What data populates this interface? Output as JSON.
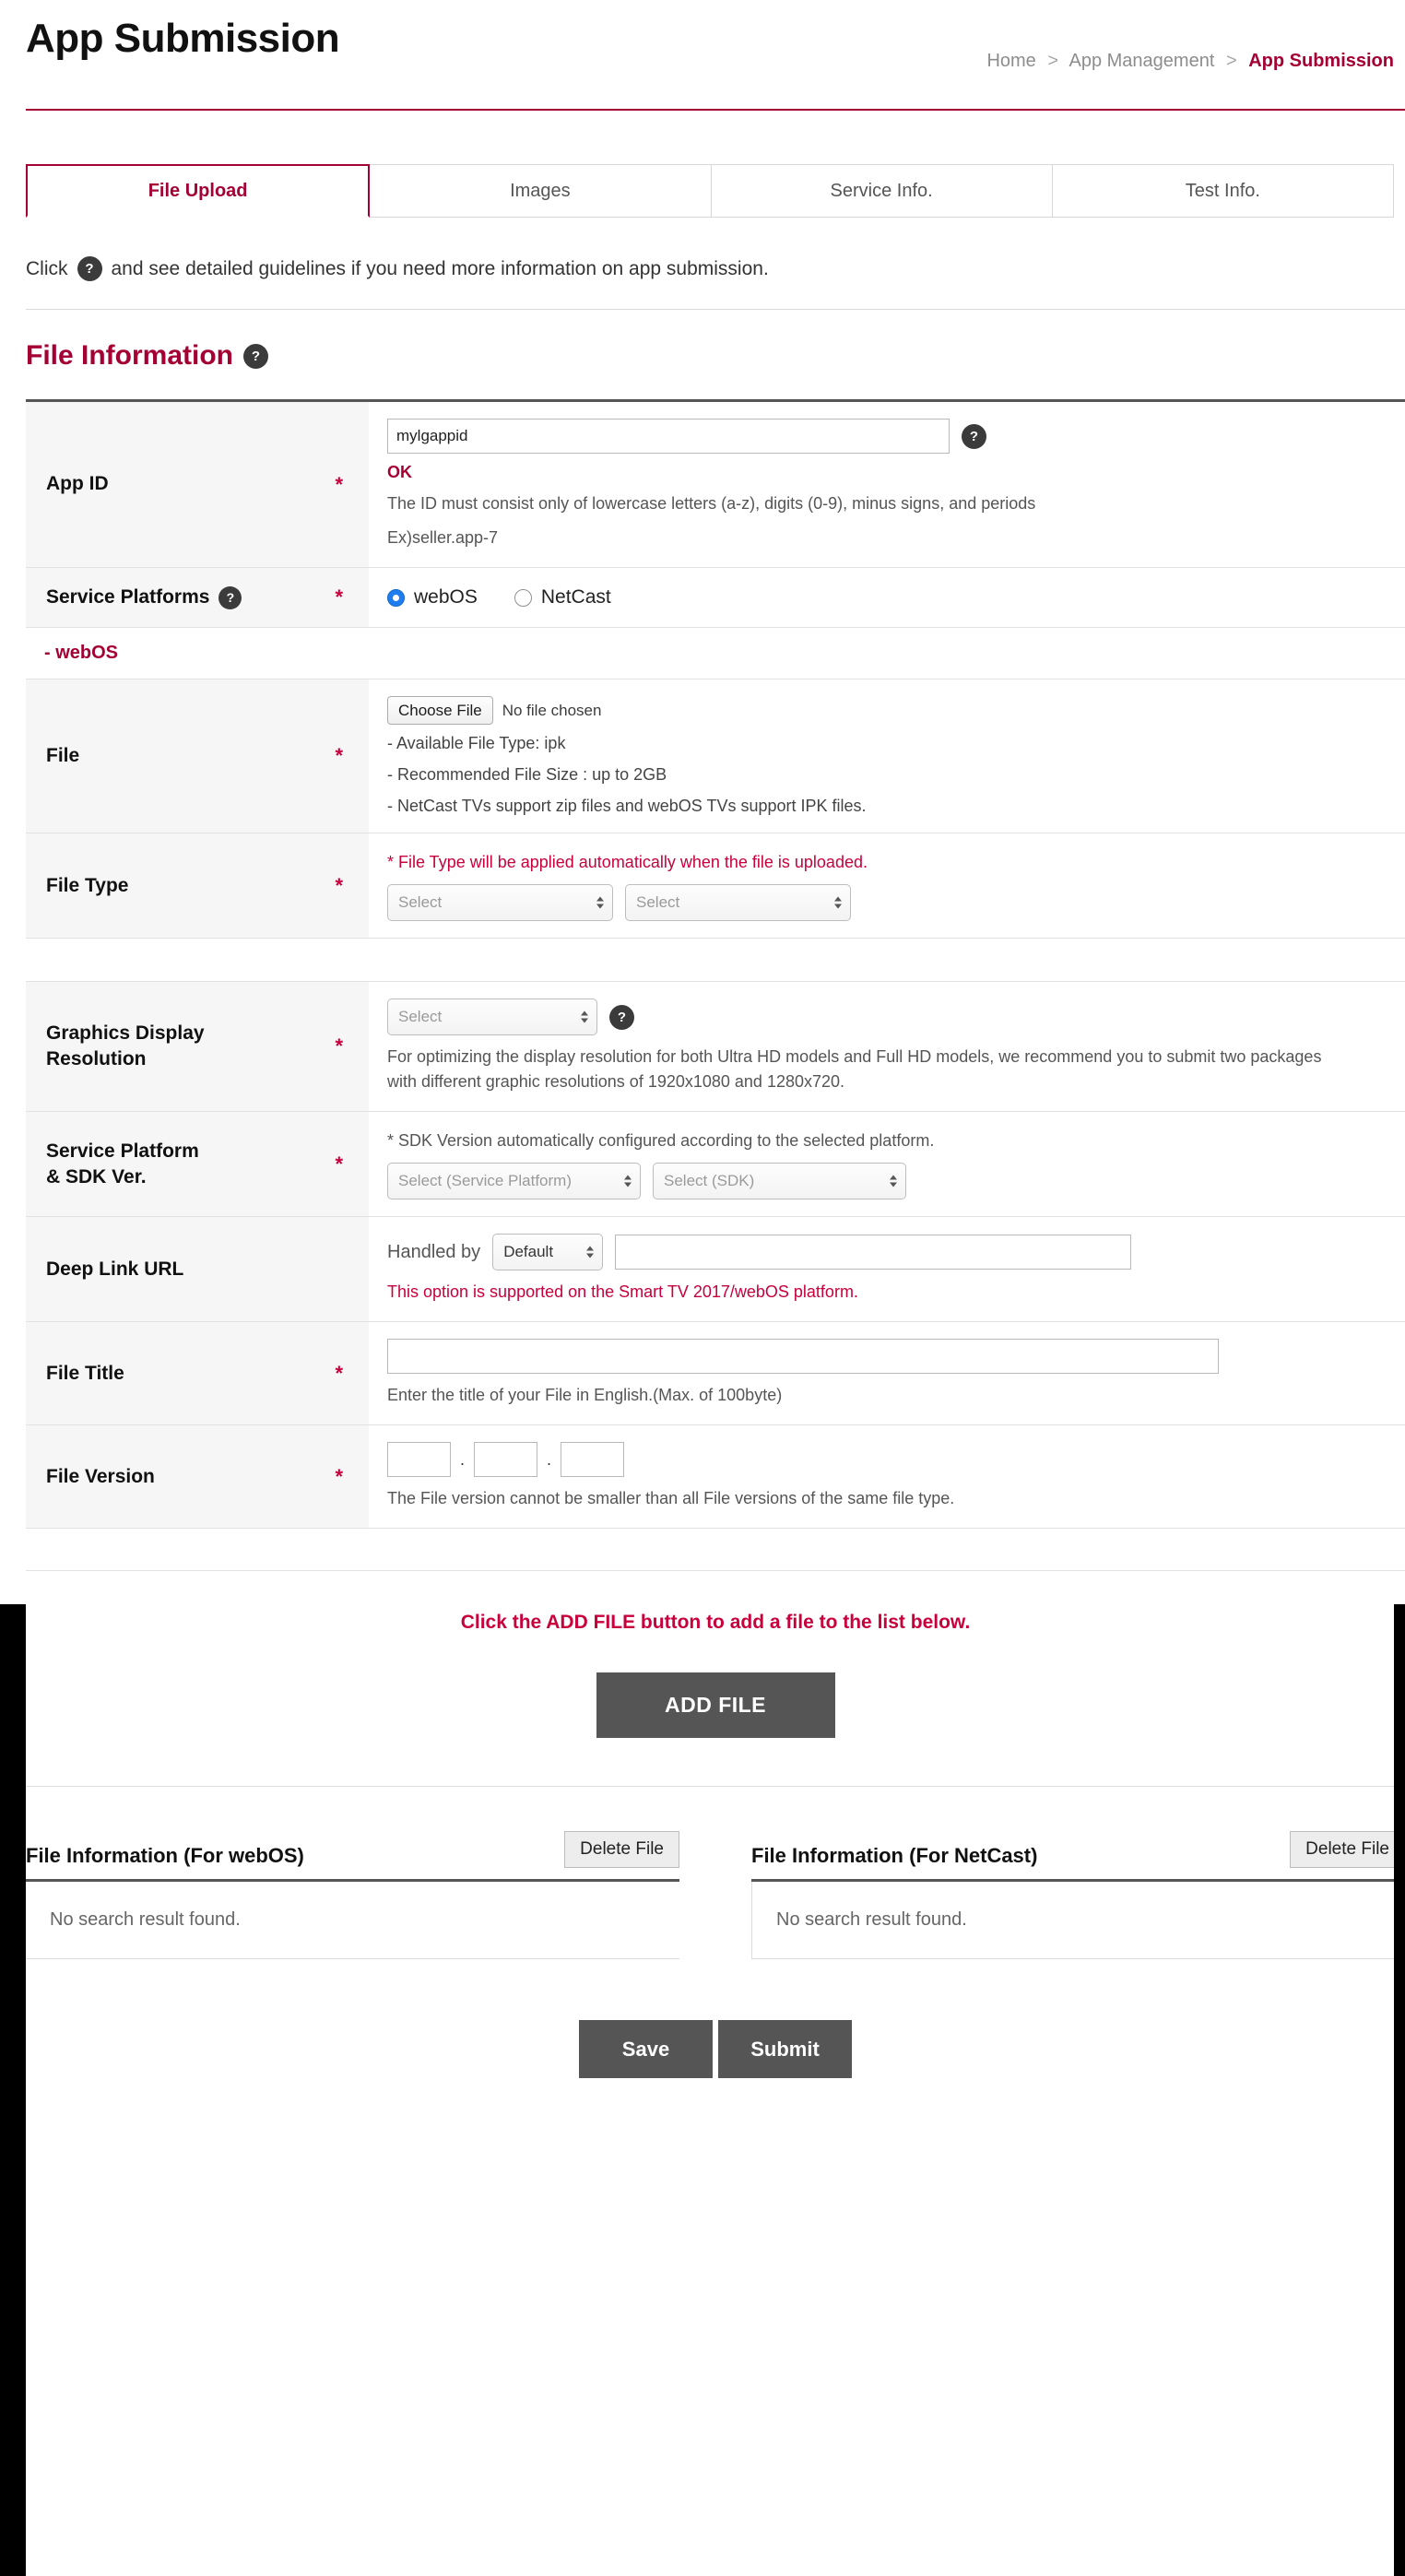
{
  "header": {
    "title": "App Submission",
    "breadcrumb": {
      "home": "Home",
      "section": "App Management",
      "current": "App Submission",
      "separator": ">"
    }
  },
  "tabs": [
    {
      "label": "File Upload",
      "active": true
    },
    {
      "label": "Images",
      "active": false
    },
    {
      "label": "Service Info.",
      "active": false
    },
    {
      "label": "Test Info.",
      "active": false
    }
  ],
  "notice": {
    "before": "Click",
    "icon": "help-icon",
    "after": "and see detailed guidelines if you need more information on app submission."
  },
  "section": {
    "title": "File Information",
    "help_icon": "help-icon"
  },
  "form": {
    "app_id": {
      "label": "App ID",
      "required": "*",
      "value": "mylgappid",
      "status": "OK",
      "hint_line1": "The ID must consist only of lowercase letters (a-z), digits (0-9), minus signs, and periods",
      "hint_line2": "Ex)seller.app-7"
    },
    "service_platforms": {
      "label": "Service Platforms",
      "required": "*",
      "options": [
        {
          "label": "webOS",
          "selected": true
        },
        {
          "label": "NetCast",
          "selected": false
        }
      ]
    },
    "subsection_webos": "- webOS",
    "file": {
      "label": "File",
      "required": "*",
      "choose_button": "Choose File",
      "no_file_text": "No file chosen",
      "bullets": [
        "- Available File Type: ipk",
        "- Recommended File Size : up to 2GB",
        "- NetCast TVs support zip files and webOS TVs support IPK files."
      ]
    },
    "file_type": {
      "label": "File Type",
      "required": "*",
      "note": "* File Type will be applied automatically when the file is uploaded.",
      "select_left": "Select",
      "select_right": "Select"
    },
    "graphics_resolution": {
      "label_line1": "Graphics Display",
      "label_line2": "Resolution",
      "required": "*",
      "select": "Select",
      "hint": "For optimizing the display resolution for both Ultra HD models and Full HD models, we recommend you to submit two packages with different graphic resolutions of 1920x1080 and 1280x720."
    },
    "service_platform_sdk": {
      "label_line1": "Service Platform",
      "label_line2": "& SDK Ver.",
      "required": "*",
      "note": "* SDK Version automatically configured according to the selected platform.",
      "select_platform": "Select (Service Platform)",
      "select_sdk": "Select (SDK)"
    },
    "deep_link_url": {
      "label": "Deep Link URL",
      "handled_by_label": "Handled by",
      "handled_by_value": "Default",
      "url_value": "",
      "note": "This option is supported on the Smart TV 2017/webOS platform."
    },
    "file_title": {
      "label": "File Title",
      "required": "*",
      "value": "",
      "hint": "Enter the title of your File in English.(Max. of 100byte)"
    },
    "file_version": {
      "label": "File Version",
      "required": "*",
      "major": "",
      "minor": "",
      "patch": "",
      "separator": ".",
      "hint": "The File version cannot be smaller than all File versions of the same file type."
    }
  },
  "add_file": {
    "message": "Click the ADD FILE button to add a file to the list below.",
    "button": "ADD FILE"
  },
  "lists": [
    {
      "title": "File Information (For webOS)",
      "delete_button": "Delete File",
      "empty_text": "No search result found."
    },
    {
      "title": "File Information (For NetCast)",
      "delete_button": "Delete File",
      "empty_text": "No search result found."
    }
  ],
  "footer": {
    "save": "Save",
    "submit": "Submit"
  },
  "colors": {
    "brand": "#a50034",
    "accent_red": "#c8003c",
    "dark_button": "#555555",
    "radio_blue": "#1e7ef0"
  }
}
